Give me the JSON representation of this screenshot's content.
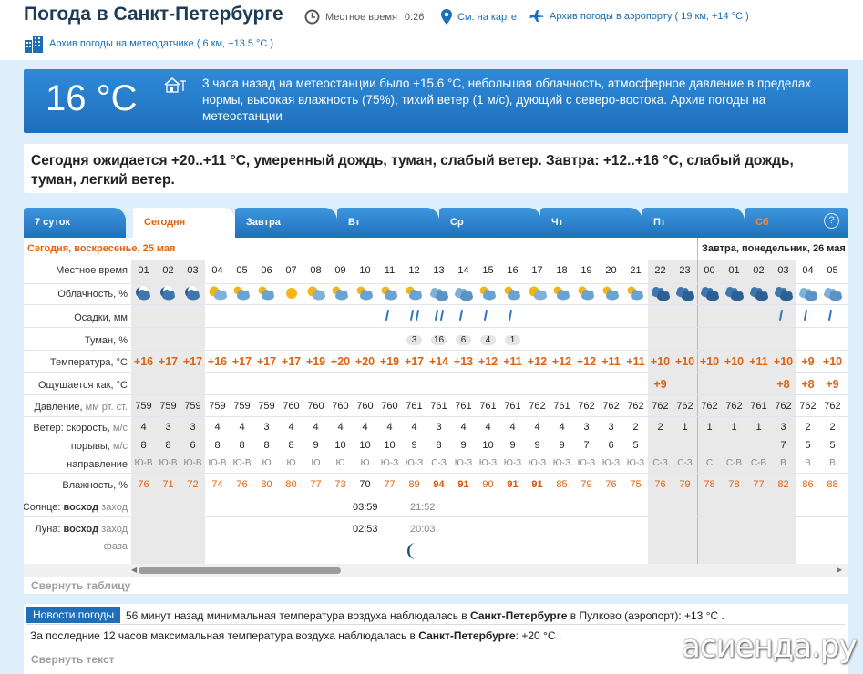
{
  "header": {
    "title": "Погода в Санкт-Петербурге",
    "local_time_label": "Местное время",
    "local_time_value": "0:26",
    "map_link": "См. на карте",
    "airport_archive": "Архив погоды в аэропорту ( 19 км, +14 °C )",
    "station_archive": "Архив погоды на метеодатчике ( 6 км, +13.5 °C )"
  },
  "current": {
    "temp": "16 °C",
    "text": "3 часа назад на метеостанции было +15.6 °C, небольшая облачность, атмосферное давление в пределах нормы, высокая влажность (75%), тихий ветер (1 м/с), дующий с северо-востока. Архив погоды на метеостанции"
  },
  "summary": "Сегодня ожидается +20..+11 °C, умеренный дождь, туман, слабый ветер. Завтра: +12..+16 °C, слабый дождь, туман, легкий ветер.",
  "tabs": [
    "7 суток",
    "Сегодня",
    "Завтра",
    "Вт",
    "Ср",
    "Чт",
    "Пт",
    "Сб"
  ],
  "tab_help": "?",
  "days": {
    "today": "Сегодня, воскресенье, 25 мая",
    "tomorrow": "Завтра, понедельник, 26 мая"
  },
  "row_labels": {
    "time": "Местное время",
    "cloud": "Облачность, %",
    "precip": "Осадки, мм",
    "fog": "Туман, %",
    "temp": "Температура, °C",
    "feels": "Ощущается как, °C",
    "pressure_main": "Давление,",
    "pressure_unit": "мм рт. ст.",
    "wind_main": "Ветер: скорость,",
    "wind_unit": "м/с",
    "gust_main": "порывы,",
    "gust_unit": "м/с",
    "direction": "направление",
    "humidity": "Влажность, %",
    "sun_main": "Солнце:",
    "sunrise": "восход",
    "sunset": "заход",
    "moon_main": "Луна:",
    "moonrise": "восход",
    "moonset": "заход",
    "phase": "фаза"
  },
  "hours": [
    "01",
    "02",
    "03",
    "04",
    "05",
    "06",
    "07",
    "08",
    "09",
    "10",
    "11",
    "12",
    "13",
    "14",
    "15",
    "16",
    "17",
    "18",
    "19",
    "20",
    "21",
    "22",
    "23",
    "00",
    "01",
    "02",
    "03",
    "04",
    "05"
  ],
  "night_flags": [
    1,
    1,
    1,
    0,
    0,
    0,
    0,
    0,
    0,
    0,
    0,
    0,
    0,
    0,
    0,
    0,
    0,
    0,
    0,
    0,
    0,
    1,
    1,
    1,
    1,
    1,
    1,
    0,
    0
  ],
  "cloud_icons": [
    "night-partly",
    "night-partly",
    "night-partly",
    "sun-cloud",
    "cloud-sun",
    "cloud-sun",
    "sun",
    "sun-cloud",
    "cloud-sun",
    "cloud-sun",
    "cloud-sun",
    "cloud-sun",
    "clouds",
    "clouds",
    "cloud-sun",
    "cloud-sun",
    "sun-cloud",
    "cloud-sun",
    "cloud-sun",
    "cloud-sun",
    "cloud-sun",
    "dark-clouds",
    "dark-clouds",
    "dark-clouds",
    "dark-clouds",
    "dark-clouds",
    "dark-clouds",
    "clouds",
    "clouds"
  ],
  "precip_icons": [
    "",
    "",
    "",
    "",
    "",
    "",
    "",
    "",
    "",
    "",
    "",
    "",
    "",
    "",
    "",
    "",
    "",
    "",
    "",
    "",
    "",
    "",
    "",
    "",
    "",
    "",
    "",
    "",
    ""
  ],
  "rain_drops": [
    0,
    0,
    0,
    0,
    0,
    0,
    0,
    0,
    0,
    0,
    1,
    2,
    2,
    1,
    1,
    1,
    0,
    0,
    0,
    0,
    0,
    0,
    0,
    0,
    0,
    0,
    1,
    1,
    1
  ],
  "fog": [
    "",
    "",
    "",
    "",
    "",
    "",
    "",
    "",
    "",
    "",
    "",
    "3",
    "16",
    "6",
    "4",
    "1",
    "",
    "",
    "",
    "",
    "",
    "",
    "",
    "",
    "",
    "",
    "",
    "",
    ""
  ],
  "temps": [
    "+16",
    "+17",
    "+17",
    "+16",
    "+17",
    "+17",
    "+17",
    "+19",
    "+20",
    "+20",
    "+19",
    "+17",
    "+14",
    "+13",
    "+12",
    "+11",
    "+12",
    "+12",
    "+12",
    "+11",
    "+11",
    "+10",
    "+10",
    "+10",
    "+10",
    "+11",
    "+10",
    "+9",
    "+10"
  ],
  "feels": [
    "",
    "",
    "",
    "",
    "",
    "",
    "",
    "",
    "",
    "",
    "",
    "",
    "",
    "",
    "",
    "",
    "",
    "",
    "",
    "",
    "",
    "+9",
    "",
    "",
    "",
    "",
    "+8",
    "+8",
    "+9"
  ],
  "pressure": [
    "759",
    "759",
    "759",
    "759",
    "759",
    "759",
    "760",
    "760",
    "760",
    "760",
    "760",
    "761",
    "761",
    "761",
    "761",
    "761",
    "762",
    "761",
    "762",
    "762",
    "762",
    "762",
    "762",
    "762",
    "762",
    "761",
    "762",
    "762",
    "762"
  ],
  "wind": [
    "4",
    "3",
    "3",
    "4",
    "4",
    "3",
    "4",
    "4",
    "4",
    "4",
    "4",
    "4",
    "3",
    "4",
    "4",
    "4",
    "4",
    "4",
    "3",
    "3",
    "2",
    "2",
    "1",
    "1",
    "1",
    "1",
    "3",
    "2",
    "2"
  ],
  "gusts": [
    "8",
    "8",
    "6",
    "8",
    "8",
    "8",
    "8",
    "9",
    "10",
    "10",
    "10",
    "9",
    "8",
    "9",
    "10",
    "9",
    "9",
    "9",
    "7",
    "6",
    "5",
    "",
    "",
    "",
    "",
    "",
    "7",
    "5",
    "5"
  ],
  "direction": [
    "Ю-В",
    "Ю-В",
    "Ю-В",
    "Ю-В",
    "Ю-В",
    "Ю",
    "Ю",
    "Ю",
    "Ю",
    "Ю",
    "Ю-З",
    "Ю-З",
    "С-З",
    "Ю-З",
    "Ю-З",
    "Ю-З",
    "Ю-З",
    "Ю-З",
    "Ю-З",
    "Ю-З",
    "Ю-З",
    "С-З",
    "С-З",
    "С",
    "С-В",
    "С-В",
    "В",
    "В",
    "В"
  ],
  "humidity": [
    "76",
    "71",
    "72",
    "74",
    "76",
    "80",
    "80",
    "77",
    "73",
    "70",
    "77",
    "89",
    "94",
    "91",
    "90",
    "91",
    "91",
    "85",
    "79",
    "76",
    "75",
    "76",
    "79",
    "78",
    "78",
    "77",
    "82",
    "86",
    "88"
  ],
  "humidity_style": [
    "",
    "",
    "",
    "",
    "",
    "",
    "",
    "",
    "",
    "black",
    "",
    "",
    "bold",
    "bold",
    "",
    "bold",
    "bold",
    "",
    "",
    "",
    "",
    "",
    "",
    "",
    "",
    "",
    "",
    "",
    ""
  ],
  "sun": {
    "rise": "03:59",
    "set": "21:52"
  },
  "moon": {
    "rise": "02:53",
    "set": "20:03"
  },
  "collapse_table": "Свернуть таблицу",
  "news": {
    "tag": "Новости погоды",
    "line1_a": "56 минут назад минимальная температура воздуха наблюдалась в ",
    "line1_city": "Санкт-Петербурге",
    "line1_b": " в Пулково (аэропорт): +13 °C .",
    "line2_a": "За последние 12 часов максимальная температура воздуха наблюдалась в ",
    "line2_city": "Санкт-Петербурге",
    "line2_b": ": +20 °C ."
  },
  "collapse_text": "Свернуть текст",
  "watermark": "асиенда.ру",
  "colors": {
    "brand_blue": "#1e6fbb",
    "accent_orange": "#e0620e",
    "night_shade": "#e9e9e9"
  }
}
